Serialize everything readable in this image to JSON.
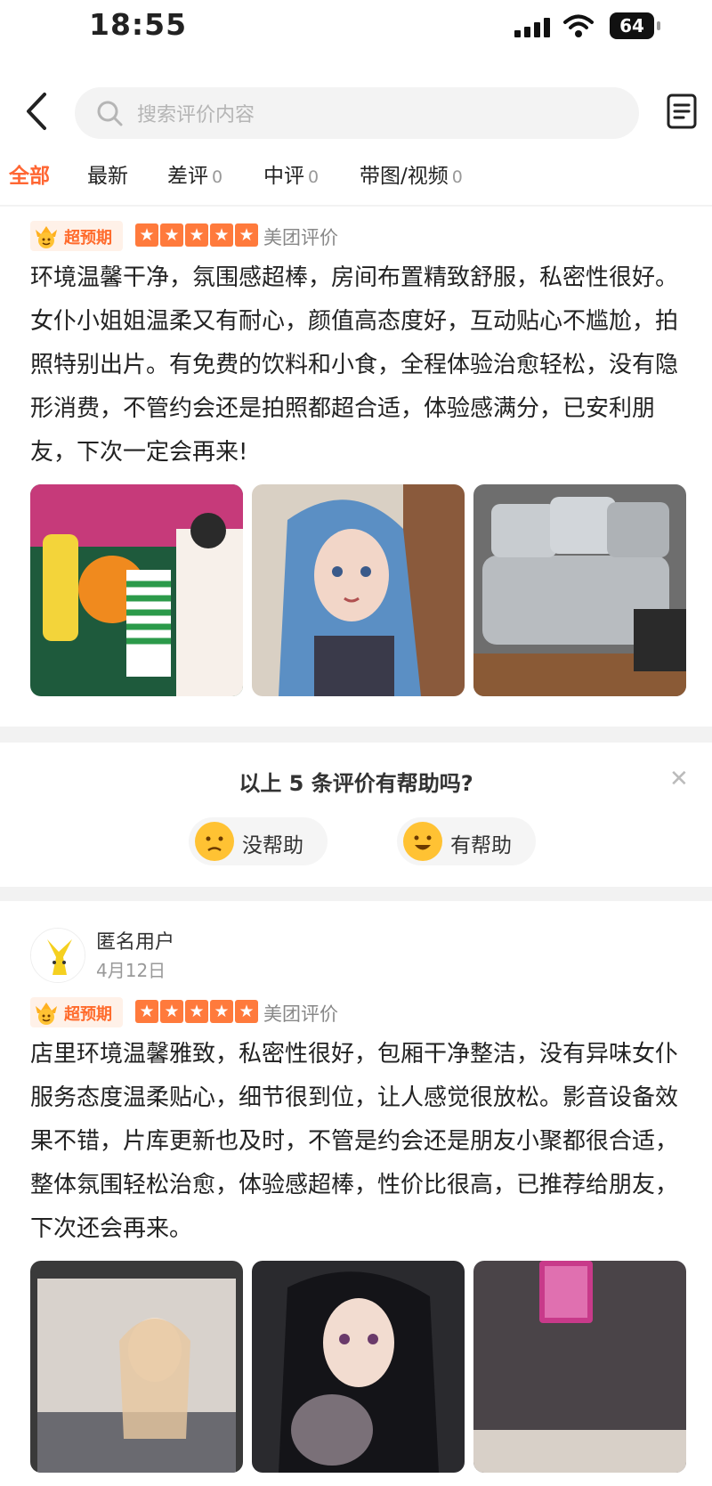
{
  "status_bar": {
    "time": "18:55",
    "battery": "64"
  },
  "header": {
    "search_placeholder": "搜索评价内容",
    "tabs": [
      {
        "label": "全部",
        "count": ""
      },
      {
        "label": "最新",
        "count": ""
      },
      {
        "label": "差评",
        "count": "0"
      },
      {
        "label": "中评",
        "count": "0"
      },
      {
        "label": "带图/视频",
        "count": "0"
      }
    ]
  },
  "reviews": [
    {
      "badge": "超预期",
      "source": "美团评价",
      "rating": 5,
      "text": "环境温馨干净，氛围感超棒，房间布置精致舒服，私密性很好。女仆小姐姐温柔又有耐心，颜值高态度好，互动贴心不尴尬，拍照特别出片。有免费的饮料和小食，全程体验治愈轻松，没有隐形消费，不管约会还是拍照都超合适，体验感满分，已安利朋友，下次一定会再来!"
    },
    {
      "user": "匿名用户",
      "date": "4月12日",
      "badge": "超预期",
      "source": "美团评价",
      "rating": 5,
      "text": "店里环境温馨雅致，私密性很好，包厢干净整洁，没有异味女仆服务态度温柔贴心，细节很到位，让人感觉很放松。影音设备效果不错，片库更新也及时，不管是约会还是朋友小聚都很合适，整体氛围轻松治愈，体验感超棒，性价比很高，已推荐给朋友，下次还会再来。"
    }
  ],
  "helpful_prompt": {
    "question": "以上 5 条评价有帮助吗?",
    "no_label": "没帮助",
    "yes_label": "有帮助"
  },
  "colors": {
    "accent": "#ff6633",
    "star": "#ff7a3c"
  }
}
